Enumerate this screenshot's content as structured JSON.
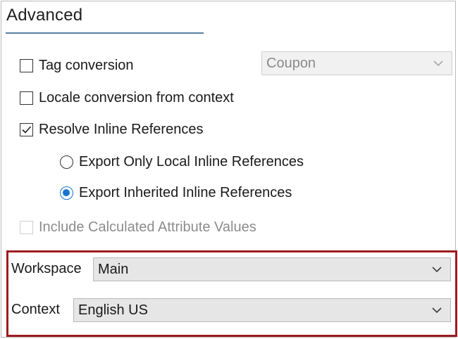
{
  "section": {
    "title": "Advanced"
  },
  "options": {
    "tag_conversion": {
      "label": "Tag conversion",
      "checked": false
    },
    "tag_conversion_select": {
      "value": "Coupon",
      "enabled": false
    },
    "locale_conversion": {
      "label": "Locale conversion from context",
      "checked": false
    },
    "resolve_inline": {
      "label": "Resolve Inline References",
      "checked": true
    },
    "export_local": {
      "label": "Export Only Local Inline References",
      "selected": false
    },
    "export_inherited": {
      "label": "Export Inherited Inline References",
      "selected": true
    },
    "include_calculated": {
      "label": "Include Calculated Attribute Values",
      "checked": false,
      "enabled": false
    }
  },
  "workspace": {
    "label": "Workspace",
    "value": "Main"
  },
  "context": {
    "label": "Context",
    "value": "English US"
  },
  "colors": {
    "accent_radio": "#1874d0",
    "highlight_border": "#9e1c1f",
    "title_rule": "#5b7fa6",
    "combo_bg": "#e6e6e6"
  },
  "icons": {
    "check": "checkmark-icon",
    "dropdown": "chevron-down-icon"
  }
}
